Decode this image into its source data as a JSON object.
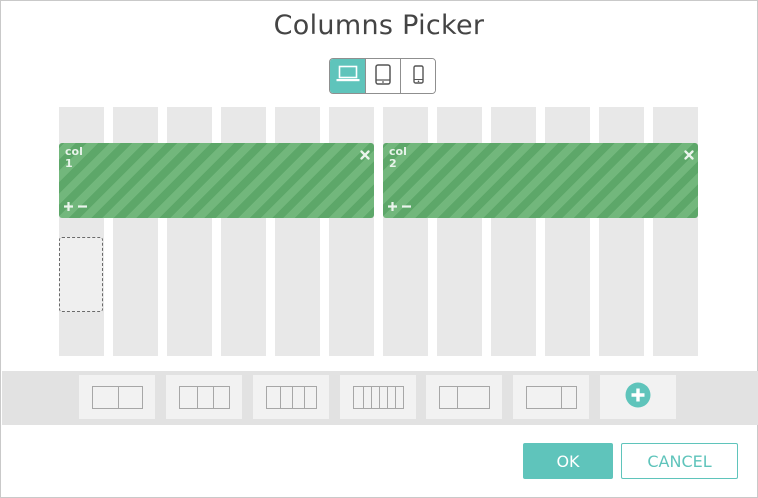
{
  "dialog": {
    "title": "Columns Picker"
  },
  "devices": [
    {
      "name": "laptop-icon",
      "active": true
    },
    {
      "name": "tablet-icon",
      "active": false
    },
    {
      "name": "phone-icon",
      "active": false
    }
  ],
  "columns": {
    "count": 12,
    "blocks": [
      {
        "label": "col\n1",
        "span": 6
      },
      {
        "label": "col\n2",
        "span": 6
      }
    ]
  },
  "presets": [
    {
      "name": "preset-2-columns",
      "columns": 2
    },
    {
      "name": "preset-3-columns",
      "columns": 3
    },
    {
      "name": "preset-4-columns",
      "columns": 4
    },
    {
      "name": "preset-6-columns",
      "columns": 6
    },
    {
      "name": "preset-wide-narrow",
      "columns": 2
    },
    {
      "name": "preset-narrow-wide",
      "columns": 2
    },
    {
      "name": "add-preset",
      "icon": "plus-circle-icon"
    }
  ],
  "buttons": {
    "ok": "OK",
    "cancel": "CANCEL"
  },
  "colors": {
    "accent": "#5fc4bb",
    "block_green": "#5da769",
    "column_bg": "#e8e8e8",
    "bar_bg": "#e2e2e2"
  }
}
